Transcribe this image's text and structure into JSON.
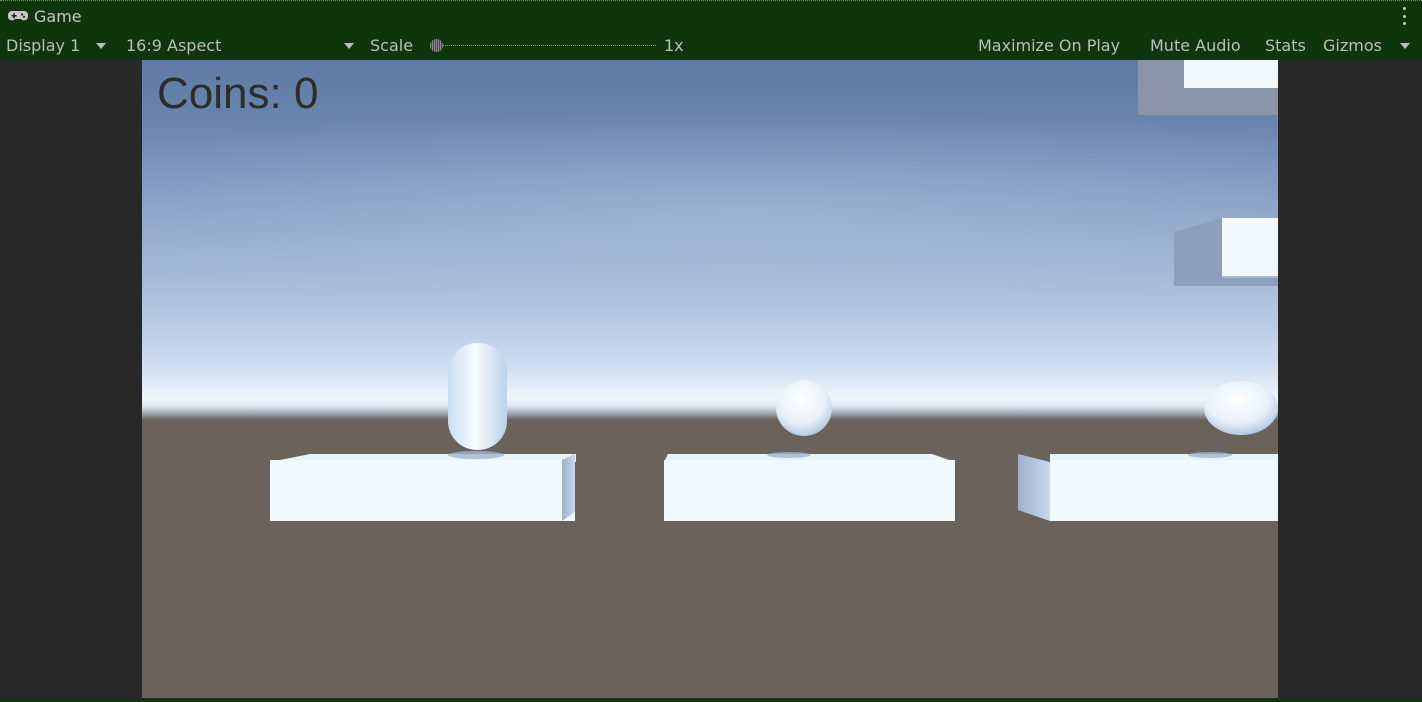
{
  "tab": {
    "title": "Game",
    "icon": "gamepad-icon"
  },
  "toolbar": {
    "display": "Display 1",
    "aspect": "16:9 Aspect",
    "scale_label": "Scale",
    "scale_value": "1x",
    "maximize_on_play": "Maximize On Play",
    "mute_audio": "Mute Audio",
    "stats": "Stats",
    "gizmos": "Gizmos"
  },
  "game": {
    "hud": {
      "coins_text": "Coins: 0"
    }
  },
  "colors": {
    "editor_header": "#0f350c",
    "editor_background": "#282828",
    "ground": "#6a635c",
    "platform": "#f2f9fd",
    "hud_text": "#2c2c2c"
  }
}
